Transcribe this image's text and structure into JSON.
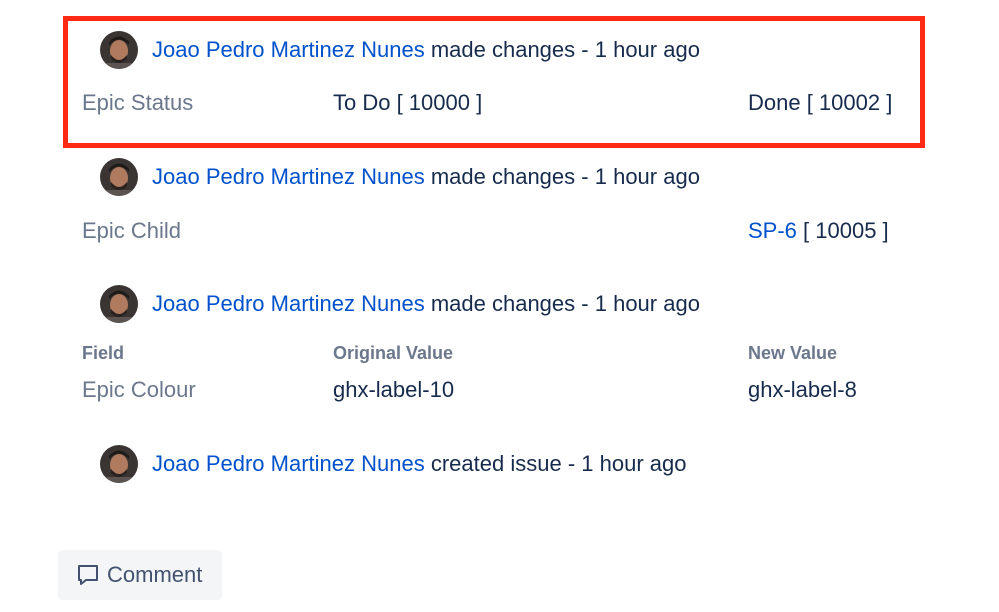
{
  "entries": [
    {
      "user": "Joao Pedro Martinez Nunes",
      "action": "made changes",
      "time": "1 hour ago",
      "field": "Epic Status",
      "original": "To Do [ 10000 ]",
      "new": "Done [ 10002 ]"
    },
    {
      "user": "Joao Pedro Martinez Nunes",
      "action": "made changes",
      "time": "1 hour ago",
      "field": "Epic Child",
      "new_link": "SP-6",
      "new_suffix": "[ 10005 ]"
    },
    {
      "user": "Joao Pedro Martinez Nunes",
      "action": "made changes",
      "time": "1 hour ago",
      "columns": {
        "field": "Field",
        "original": "Original Value",
        "new": "New Value"
      },
      "field": "Epic Colour",
      "original": "ghx-label-10",
      "new": "ghx-label-8"
    },
    {
      "user": "Joao Pedro Martinez Nunes",
      "action": "created issue",
      "time": "1 hour ago"
    }
  ],
  "separator": "-",
  "comment_button": {
    "label": "Comment",
    "icon": "comment-icon"
  },
  "colors": {
    "link": "#0052cc",
    "text": "#172b4d",
    "muted": "#6b778c",
    "highlight": "#ff2a14",
    "button_bg": "#f4f5f7"
  }
}
